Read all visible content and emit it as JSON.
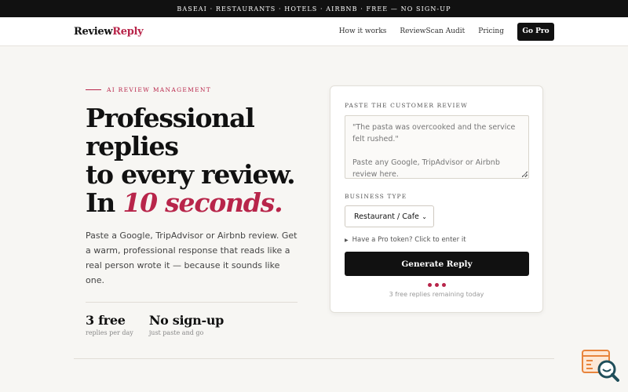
{
  "banner": {
    "text": "BASEAI · RESTAURANTS · HOTELS · AIRBNB · FREE — NO SIGN-UP"
  },
  "nav": {
    "logo_part1": "Review",
    "logo_part2": "Reply",
    "links": [
      "How it works",
      "ReviewScan Audit",
      "Pricing"
    ],
    "cta": "Go Pro"
  },
  "hero": {
    "eyebrow": "AI REVIEW MANAGEMENT",
    "headline_line1": "Professional",
    "headline_line2": "replies",
    "headline_line3": "to every review.",
    "headline_line4_prefix": "In ",
    "headline_line4_accent": "10 seconds.",
    "lead": "Paste a Google, TripAdvisor or Airbnb review. Get a warm, professional response that reads like a real person wrote it — because it sounds like one.",
    "stats": [
      {
        "value": "3 free",
        "label": "replies per day"
      },
      {
        "value": "No sign-up",
        "label": "just paste and go"
      }
    ]
  },
  "form": {
    "review_label": "PASTE THE CUSTOMER REVIEW",
    "review_placeholder": "\"The pasta was overcooked and the service felt rushed.\"\n\nPaste any Google, TripAdvisor or Airbnb review here.",
    "business_label": "BUSINESS TYPE",
    "business_value": "Restaurant / Cafe",
    "token_link": "Have a Pro token? Click to enter it",
    "generate_label": "Generate Reply",
    "remaining": "3 free replies remaining today"
  },
  "colors": {
    "accent": "#b8254a",
    "dark": "#111111",
    "background": "#f7f6f3",
    "widget_orange": "#e8843c",
    "widget_teal": "#1f4e5a"
  }
}
